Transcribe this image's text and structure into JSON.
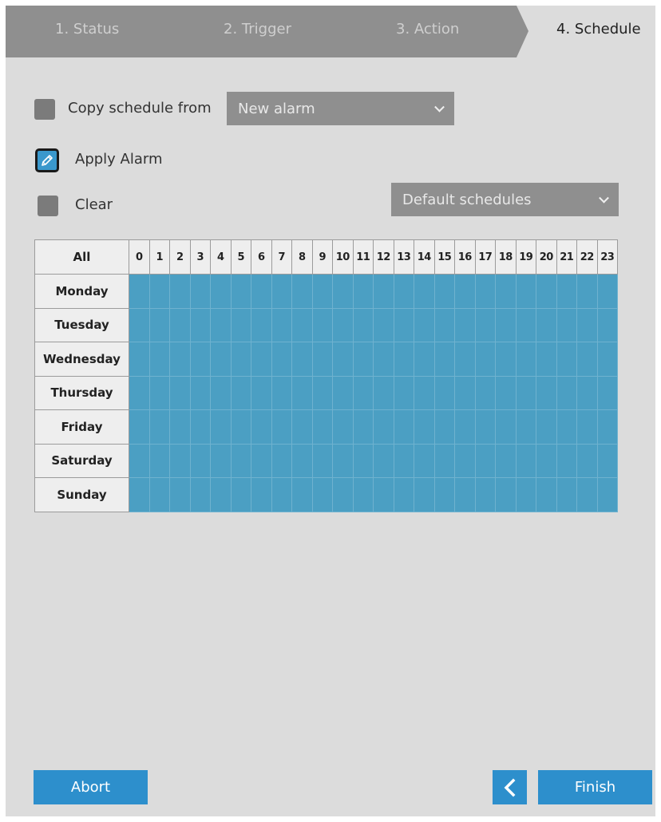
{
  "wizard": {
    "steps": [
      {
        "label": "1. Status"
      },
      {
        "label": "2. Trigger"
      },
      {
        "label": "3. Action"
      },
      {
        "label": "4. Schedule"
      }
    ],
    "active_step": "4. Schedule"
  },
  "copy_schedule": {
    "label": "Copy schedule from",
    "checked": false,
    "selected_option": "New alarm"
  },
  "apply_alarm": {
    "label": "Apply Alarm",
    "icon": "pencil-icon"
  },
  "clear": {
    "label": "Clear",
    "checked": false
  },
  "default_schedules": {
    "selected_option": "Default schedules"
  },
  "schedule": {
    "all_label": "All",
    "hours": [
      "0",
      "1",
      "2",
      "3",
      "4",
      "5",
      "6",
      "7",
      "8",
      "9",
      "10",
      "11",
      "12",
      "13",
      "14",
      "15",
      "16",
      "17",
      "18",
      "19",
      "20",
      "21",
      "22",
      "23"
    ],
    "days": [
      "Monday",
      "Tuesday",
      "Wednesday",
      "Thursday",
      "Friday",
      "Saturday",
      "Sunday"
    ],
    "all_hours_selected": true
  },
  "buttons": {
    "abort": "Abort",
    "back_icon": "chevron-left-icon",
    "finish": "Finish"
  },
  "colors": {
    "accent": "#2d8fcc",
    "selected_cell": "#4b9fc3",
    "panel": "#dcdcdc"
  }
}
